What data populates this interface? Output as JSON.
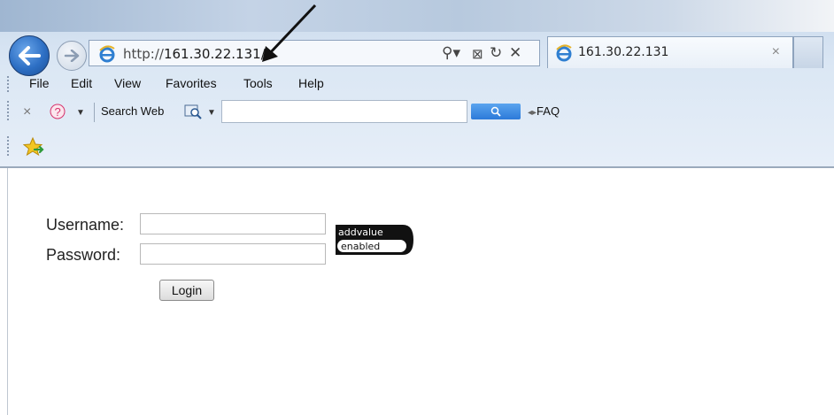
{
  "browser": {
    "address_prefix": "http://",
    "address_host": "161.30.22.131/",
    "tab_title": "161.30.22.131",
    "tab_close": "×",
    "nav_controls": [
      "⚲ ▾",
      "⊠",
      "↻",
      "✕"
    ]
  },
  "menu": [
    "File",
    "Edit",
    "View",
    "Favorites",
    "Tools",
    "Help"
  ],
  "toolbar": {
    "close_glyph": "×",
    "search_label": "Search Web",
    "search_placeholder": "",
    "faq_label": "FAQ"
  },
  "login": {
    "username_label": "Username:",
    "password_label": "Password:",
    "username_value": "",
    "password_value": "",
    "button_label": "Login"
  },
  "logo": {
    "line1": "addvalue",
    "line2": "enabled"
  },
  "colors": {
    "chrome_bg": "#dbe7f4",
    "back_button": "#2d6fc4",
    "search_button": "#3a88e0"
  },
  "icons": [
    "back-arrow-icon",
    "forward-arrow-icon",
    "ie-logo-icon",
    "search-icon",
    "compat-view-icon",
    "refresh-icon",
    "stop-icon",
    "close-icon",
    "help-icon",
    "web-search-icon",
    "favorites-star-icon"
  ]
}
